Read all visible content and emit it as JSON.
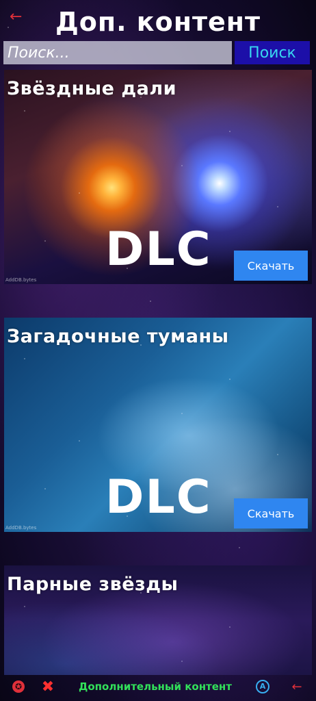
{
  "header": {
    "back_glyph": "←",
    "title": "Доп. контент"
  },
  "search": {
    "placeholder": "Поиск...",
    "button_label": "Поиск"
  },
  "dlc_items": [
    {
      "title": "Звёздные дали",
      "image_text": "DLC",
      "download_label": "Скачать",
      "watermark": "AddDB.bytes"
    },
    {
      "title": "Загадочные туманы",
      "image_text": "DLC",
      "download_label": "Скачать",
      "watermark": "AddDB.bytes"
    },
    {
      "title": "Парные звёзды"
    }
  ],
  "bottom_bar": {
    "star_glyph": "✪",
    "close_glyph": "✖",
    "content_label": "Дополнительный контент",
    "circle_glyph": "A",
    "back_glyph": "←"
  },
  "colors": {
    "title_text": "#ffffff",
    "search_button_bg": "#1c0fa8",
    "search_button_text": "#38d7f0",
    "download_button_bg": "#2f86f0",
    "bottom_link_green": "#32e05a",
    "accent_red": "#e0303a",
    "accent_blue": "#38aef0"
  },
  "icons": {
    "back": "left-arrow-icon",
    "star": "star-icon",
    "close": "close-icon",
    "circle_a": "circle-a-icon"
  }
}
